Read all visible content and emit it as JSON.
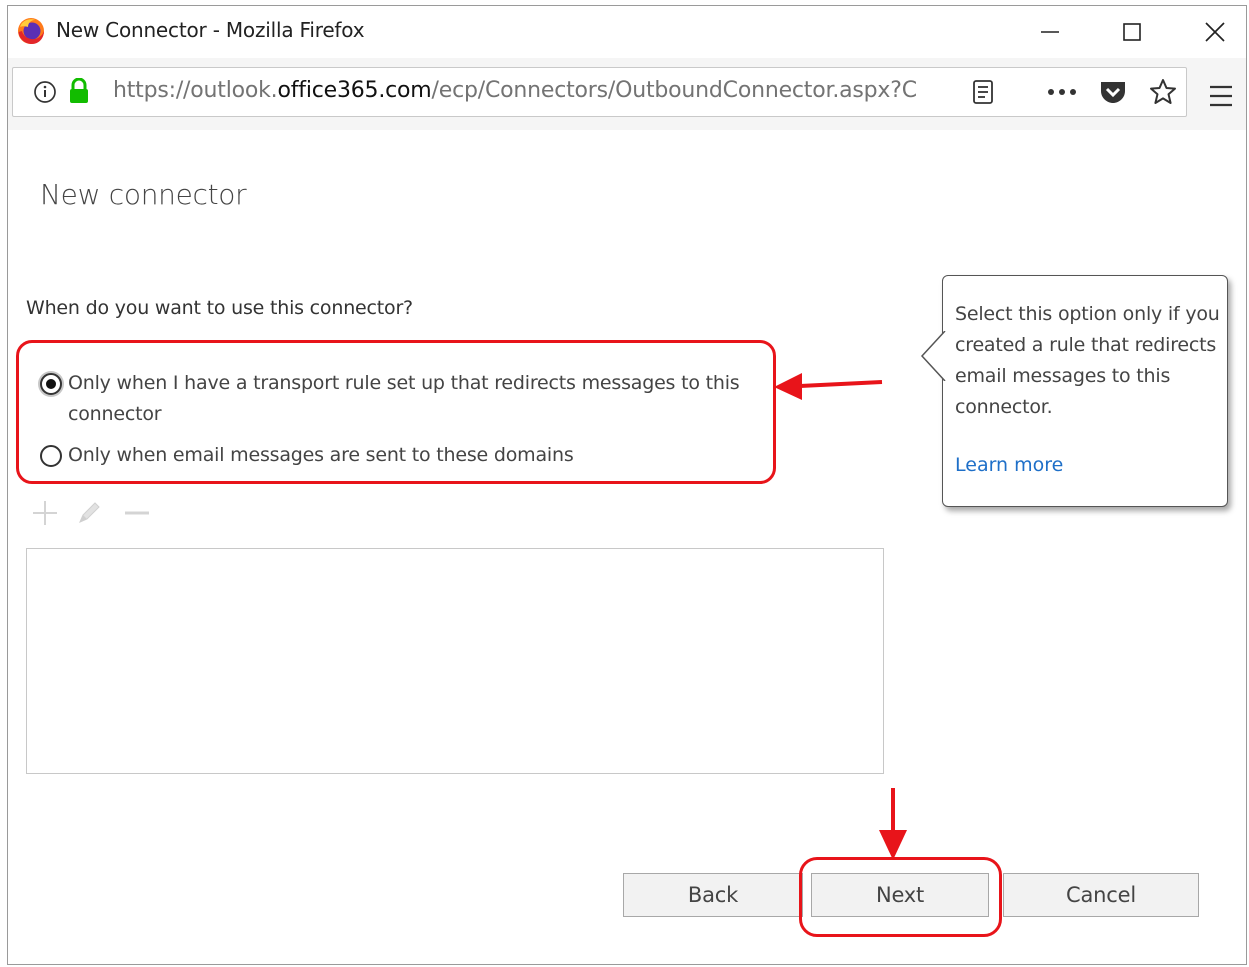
{
  "window": {
    "title": "New Connector - Mozilla Firefox",
    "controls": [
      "minimize-icon",
      "maximize-icon",
      "close-icon"
    ]
  },
  "urlbar": {
    "prefix": "https://outlook.",
    "host": "office365.com",
    "path": "/ecp/Connectors/OutboundConnector.aspx?C",
    "icons": [
      "info-icon",
      "lock-icon",
      "reader-view-icon",
      "more-icon",
      "pocket-icon",
      "bookmark-star-icon",
      "menu-icon"
    ]
  },
  "page": {
    "title": "New connector",
    "question": "When do you want to use this connector?",
    "options": [
      {
        "label": "Only when I have a transport rule set up that redirects messages to this connector",
        "selected": true
      },
      {
        "label": "Only when email messages are sent to these domains",
        "selected": false
      }
    ],
    "toolbar_icons": [
      "add-icon",
      "edit-icon",
      "remove-icon"
    ]
  },
  "callout": {
    "text": "Select this option only if you created a rule that redirects email messages to this connector.",
    "link": "Learn more"
  },
  "buttons": {
    "back": "Back",
    "next": "Next",
    "cancel": "Cancel"
  },
  "colors": {
    "annotation_red": "#e8141a",
    "link_blue": "#1e6fc8",
    "lock_green": "#12bc00"
  }
}
